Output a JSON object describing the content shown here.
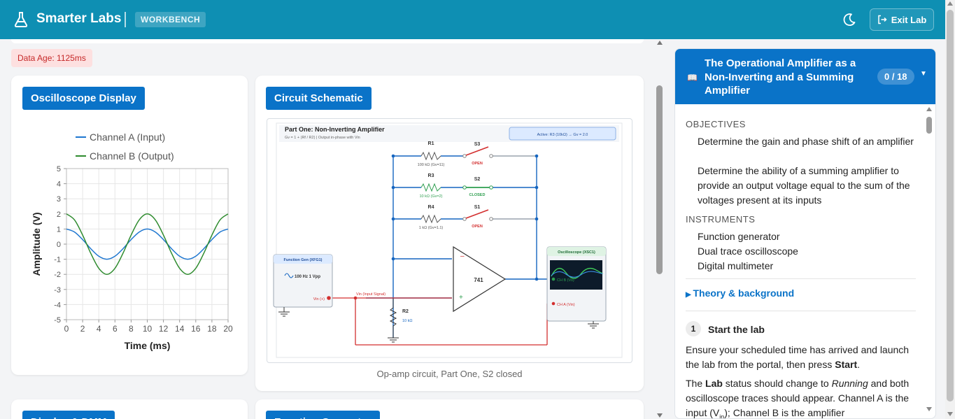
{
  "header": {
    "brand": "Smarter Labs",
    "badge": "WORKBENCH",
    "exit_label": "Exit Lab",
    "icons": [
      "flask-icon",
      "moon-icon",
      "exit-icon"
    ]
  },
  "status": {
    "data_age": "Data Age: 1125ms"
  },
  "oscilloscope": {
    "title": "Oscilloscope Display",
    "chart_data": {
      "type": "line",
      "xlabel": "Time (ms)",
      "ylabel": "Amplitude (V)",
      "xlim": [
        0,
        20
      ],
      "ylim": [
        -5,
        5
      ],
      "x_ticks": [
        "0",
        "2",
        "4",
        "6",
        "8",
        "10",
        "12",
        "14",
        "16",
        "18",
        "20"
      ],
      "y_ticks": [
        "5",
        "4",
        "3",
        "2",
        "1",
        "0",
        "-1",
        "-2",
        "-3",
        "-4",
        "-5"
      ],
      "legend_position": "top",
      "grid": true,
      "series": [
        {
          "name": "Channel A (Input)",
          "color": "#1f77d0",
          "x": [
            0,
            1,
            2,
            3,
            4,
            5,
            6,
            7,
            8,
            9,
            10,
            11,
            12,
            13,
            14,
            15,
            16,
            17,
            18,
            19,
            20
          ],
          "values": [
            1.0,
            0.8,
            0.3,
            -0.3,
            -0.8,
            -1.0,
            -0.8,
            -0.3,
            0.3,
            0.8,
            1.0,
            0.8,
            0.3,
            -0.3,
            -0.8,
            -1.0,
            -0.8,
            -0.3,
            0.3,
            0.8,
            1.0
          ]
        },
        {
          "name": "Channel B (Output)",
          "color": "#2e8b2e",
          "x": [
            0,
            1,
            2,
            3,
            4,
            5,
            6,
            7,
            8,
            9,
            10,
            11,
            12,
            13,
            14,
            15,
            16,
            17,
            18,
            19,
            20
          ],
          "values": [
            2.0,
            1.6,
            0.6,
            -0.6,
            -1.6,
            -2.0,
            -1.6,
            -0.6,
            0.6,
            1.6,
            2.0,
            1.6,
            0.6,
            -0.6,
            -1.6,
            -2.0,
            -1.6,
            -0.6,
            0.6,
            1.6,
            2.0
          ]
        }
      ]
    }
  },
  "schematic": {
    "title": "Circuit Schematic",
    "caption": "Op-amp circuit, Part One, S2 closed",
    "diagram_title": "Part One: Non-Inverting Amplifier",
    "diagram_subtitle": "Gv = 1 + (Rf / R2)  |  Output in-phase with Vin",
    "active_label": "Active: R3 (10kΩ) → Gv = 2.0",
    "resistors": [
      {
        "name": "R1",
        "value": "100 kΩ (Gv=11)",
        "switch": "S3",
        "state": "OPEN"
      },
      {
        "name": "R3",
        "value": "10 kΩ (Gv=2)",
        "switch": "S2",
        "state": "CLOSED"
      },
      {
        "name": "R4",
        "value": "1 kΩ (Gv=1.1)",
        "switch": "S1",
        "state": "OPEN"
      }
    ],
    "opamp": "741",
    "r2": {
      "name": "R2",
      "value": "10 kΩ"
    },
    "fgen": {
      "title": "Function Gen (XFG1)",
      "setting": "100 Hz  1 Vpp",
      "terminal": "Vin (+)"
    },
    "vin_label": "Vin (Input Signal)",
    "scope": {
      "title": "Oscilloscope (XSC1)",
      "ch_b": "CH B (Vo)",
      "ch_a": "CH A (Vin)"
    },
    "colors": {
      "active": "#2e9e4f",
      "open": "#d32f2f",
      "wire": "#1565c0",
      "input": "#d32f2f"
    }
  },
  "bottom_cards": [
    "Display & DMM",
    "Function Generator"
  ],
  "lab": {
    "title": "The Operational Amplifier as a Non-Inverting and a Summing Amplifier",
    "progress": "0 / 18",
    "objectives_heading": "OBJECTIVES",
    "objectives": [
      "Determine the gain and phase shift of an amplifier",
      "Determine the ability of a summing amplifier to provide an output voltage equal to the sum of the voltages present at its inputs"
    ],
    "instruments_heading": "INSTRUMENTS",
    "instruments": [
      "Function generator",
      "Dual trace oscilloscope",
      "Digital multimeter"
    ],
    "theory_link": "Theory & background",
    "step_number": "1",
    "step_title": "Start the lab",
    "step_p1_a": "Ensure your scheduled time has arrived and launch the lab from the portal, then press ",
    "step_p1_b": "Start",
    "step_p2_a": "The ",
    "step_p2_b": "Lab",
    "step_p2_c": " status should change to ",
    "step_p2_d": "Running",
    "step_p2_e": " and both oscilloscope traces should appear. Channel A is the input (V",
    "step_p2_f": "in",
    "step_p2_g": "); Channel B is the amplifier"
  }
}
